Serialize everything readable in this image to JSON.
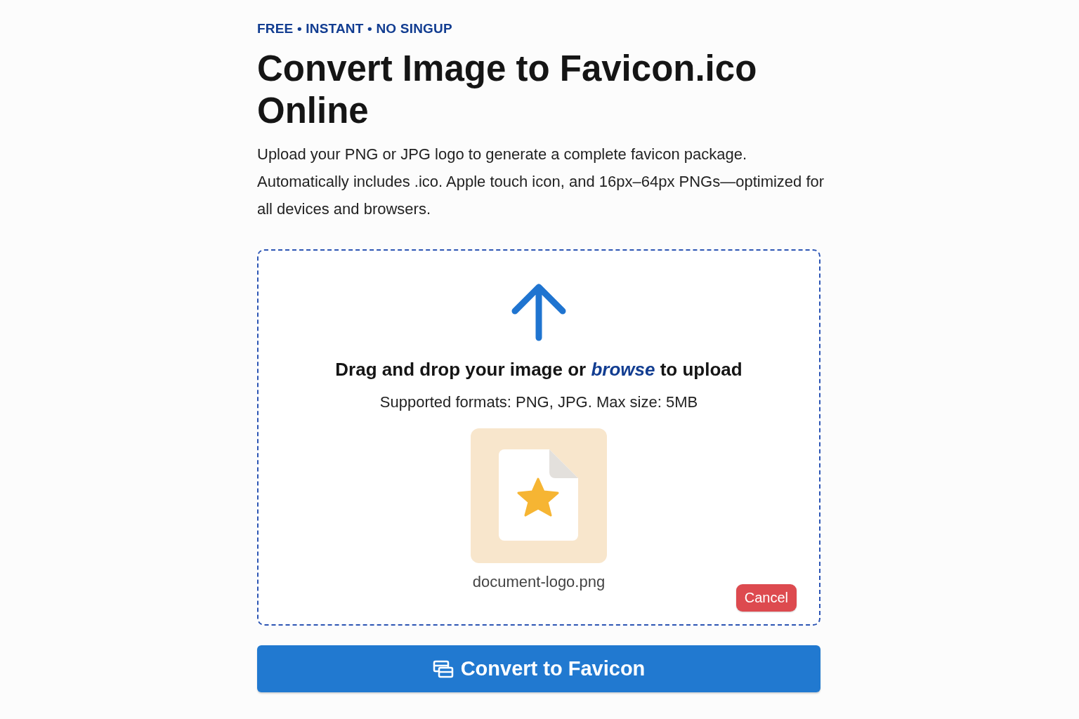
{
  "tagline": "FREE • INSTANT • NO SINGUP",
  "title": "Convert Image to Favicon.ico Online",
  "description": "Upload your PNG or JPG logo to generate a complete favicon package. Automatically includes .ico. Apple touch icon, and 16px–64px PNGs—optimized for all devices and browsers.",
  "dropzone": {
    "prompt_before": "Drag and drop your image or",
    "browse_link": "browse",
    "prompt_after": "to upload",
    "formats": "Supported formats: PNG, JPG. Max size: 5MB",
    "file": {
      "kind": "picture",
      "name": "document-logo.png"
    },
    "cancel_button": "Cancel"
  },
  "convert_button": "Convert to Favicon"
}
